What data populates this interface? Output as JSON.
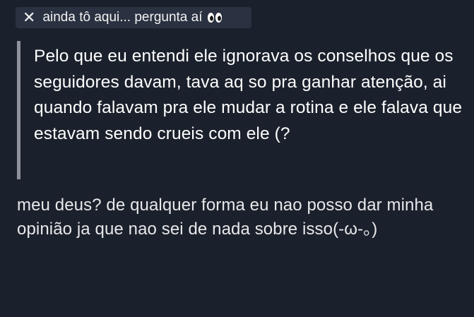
{
  "tag": {
    "text": "ainda tô aqui... pergunta aí",
    "close_icon": "close-icon",
    "emoji_icon": "eyes-icon"
  },
  "quote": {
    "text": "Pelo que eu entendi ele ignorava os conselhos que os seguidores davam, tava aq so pra ganhar atenção, ai quando falavam pra ele mudar a rotina e ele falava que estavam sendo crueis com ele (?"
  },
  "reply": {
    "text": "meu deus? de qualquer forma eu nao posso dar minha opinião ja que nao sei de nada sobre isso(-ω-｡)"
  },
  "colors": {
    "background": "#1b212c",
    "chip": "#2a3140",
    "quote_bar": "#8d929b"
  }
}
